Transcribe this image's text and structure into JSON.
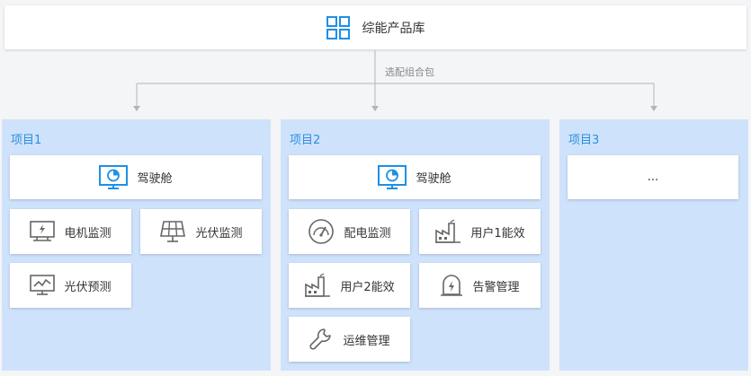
{
  "header": {
    "title": "综能产品库",
    "icon": "grid-icon",
    "accent": "#1e90e6"
  },
  "connector": {
    "label": "选配组合包"
  },
  "colors": {
    "panel_bg": "#cfe2fb",
    "label_blue": "#2b8fe0",
    "line": "#b5b5b5"
  },
  "projects": [
    {
      "label": "项目1",
      "cockpit": "驾驶舱",
      "modules": [
        "电机监测",
        "光伏监测",
        "光伏预测"
      ]
    },
    {
      "label": "项目2",
      "cockpit": "驾驶舱",
      "modules": [
        "配电监测",
        "用户1能效",
        "用户2能效",
        "告警管理",
        "运维管理"
      ]
    },
    {
      "label": "项目3",
      "placeholder": "..."
    }
  ]
}
